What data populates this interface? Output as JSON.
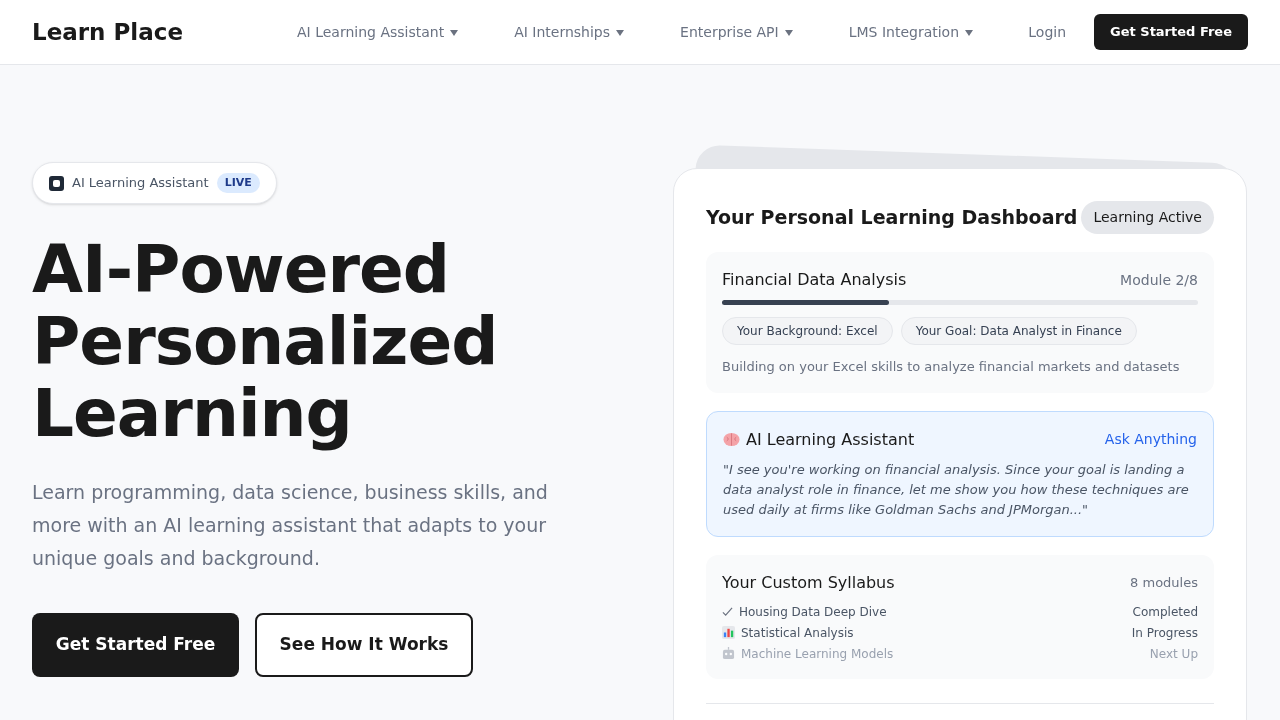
{
  "header": {
    "logo": "Learn Place",
    "nav": [
      {
        "label": "AI Learning Assistant"
      },
      {
        "label": "AI Internships"
      },
      {
        "label": "Enterprise API"
      },
      {
        "label": "LMS Integration"
      }
    ],
    "login": "Login",
    "cta": "Get Started Free"
  },
  "hero": {
    "badge": {
      "label": "AI Learning Assistant",
      "tag": "LIVE"
    },
    "title_lines": [
      "AI-Powered",
      "Personalized",
      "Learning"
    ],
    "subtitle": "Learn programming, data science, business skills, and more with an AI learning assistant that adapts to your unique goals and background.",
    "primary": "Get Started Free",
    "secondary": "See How It Works"
  },
  "dashboard": {
    "title": "Your Personal Learning Dashboard",
    "status": "Learning Active",
    "module": {
      "title": "Financial Data Analysis",
      "counter": "Module 2/8",
      "level": 0.35,
      "tags": [
        "Your Background: Excel",
        "Your Goal: Data Analyst in Finance"
      ],
      "description": "Building on your Excel skills to analyze financial markets and datasets"
    },
    "assistant": {
      "title": "AI Learning Assistant",
      "action": "Ask Anything",
      "quote": "\"I see you're working on financial analysis. Since your goal is landing a data analyst role in finance, let me show you how these techniques are used daily at firms like Goldman Sachs and JPMorgan...\""
    },
    "syllabus": {
      "title": "Your Custom Syllabus",
      "count": "8 modules",
      "items": [
        {
          "name": "Housing Data Deep Dive",
          "status": "Completed",
          "kind": "done"
        },
        {
          "name": "Statistical Analysis",
          "status": "In Progress",
          "kind": "current"
        },
        {
          "name": "Machine Learning Models",
          "status": "Next Up",
          "kind": "upcoming"
        }
      ]
    }
  }
}
